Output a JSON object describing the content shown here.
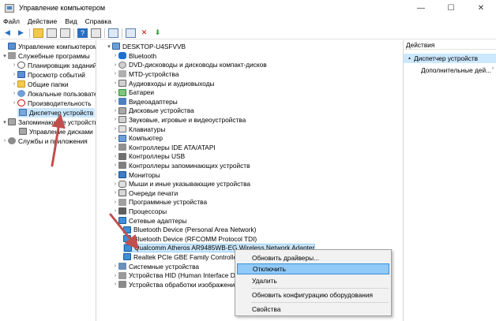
{
  "window": {
    "title": "Управление компьютером",
    "minimize": "—",
    "maximize": "☐",
    "close": "✕"
  },
  "menu": [
    "Файл",
    "Действие",
    "Вид",
    "Справка"
  ],
  "left_tree": [
    {
      "label": "Управление компьютером (л",
      "icon": "computer-icon",
      "exp": ""
    },
    {
      "label": "Служебные программы",
      "icon": "tools-icon",
      "exp": "▾"
    },
    {
      "label": "Планировщик заданий",
      "icon": "clock-icon",
      "exp": "›"
    },
    {
      "label": "Просмотр событий",
      "icon": "event-viewer-icon",
      "exp": "›"
    },
    {
      "label": "Общие папки",
      "icon": "folder-icon",
      "exp": "›"
    },
    {
      "label": "Локальные пользовате",
      "icon": "users-icon",
      "exp": "›"
    },
    {
      "label": "Производительность",
      "icon": "performance-icon",
      "exp": "›"
    },
    {
      "label": "Диспетчер устройств",
      "icon": "device-manager-icon",
      "exp": ""
    },
    {
      "label": "Запоминающие устройств",
      "icon": "storage-icon",
      "exp": "▾"
    },
    {
      "label": "Управление дисками",
      "icon": "disk-icon",
      "exp": ""
    },
    {
      "label": "Службы и приложения",
      "icon": "services-icon",
      "exp": "›"
    }
  ],
  "device_tree": {
    "root": "DESKTOP-U4SFVVB",
    "items": [
      {
        "label": "Bluetooth",
        "icon": "bluetooth-icon",
        "exp": "›"
      },
      {
        "label": "DVD-дисководы и дисководы компакт-дисков",
        "icon": "dvd-icon",
        "exp": "›"
      },
      {
        "label": "MTD-устройства",
        "icon": "mtd-icon",
        "exp": "›"
      },
      {
        "label": "Аудиовходы и аудиовыходы",
        "icon": "audio-icon",
        "exp": "›"
      },
      {
        "label": "Батареи",
        "icon": "battery-icon",
        "exp": "›"
      },
      {
        "label": "Видеоадаптеры",
        "icon": "video-adapter-icon",
        "exp": "›"
      },
      {
        "label": "Дисковые устройства",
        "icon": "disk-drive-icon",
        "exp": "›"
      },
      {
        "label": "Звуковые, игровые и видеоустройства",
        "icon": "sound-icon",
        "exp": "›"
      },
      {
        "label": "Клавиатуры",
        "icon": "keyboard-icon",
        "exp": "›"
      },
      {
        "label": "Компьютер",
        "icon": "computer-icon",
        "exp": "›"
      },
      {
        "label": "Контроллеры IDE ATA/ATAPI",
        "icon": "ide-icon",
        "exp": "›"
      },
      {
        "label": "Контроллеры USB",
        "icon": "usb-icon",
        "exp": "›"
      },
      {
        "label": "Контроллеры запоминающих устройств",
        "icon": "storage-controller-icon",
        "exp": "›"
      },
      {
        "label": "Мониторы",
        "icon": "monitor-icon",
        "exp": "›"
      },
      {
        "label": "Мыши и иные указывающие устройства",
        "icon": "mouse-icon",
        "exp": "›"
      },
      {
        "label": "Очереди печати",
        "icon": "print-queue-icon",
        "exp": "›"
      },
      {
        "label": "Программные устройства",
        "icon": "software-device-icon",
        "exp": "›"
      },
      {
        "label": "Процессоры",
        "icon": "processor-icon",
        "exp": "›"
      },
      {
        "label": "Сетевые адаптеры",
        "icon": "network-adapter-icon",
        "exp": "▾"
      }
    ],
    "network_children": [
      "Bluetooth Device (Personal Area Network)",
      "Bluetooth Device (RFCOMM Protocol TDI)",
      "Qualcomm Atheros AR9485WB-EG Wireless Network Adapter",
      "Realtek PCIe GBE Family Controller"
    ],
    "after_items": [
      {
        "label": "Системные устройства",
        "icon": "system-device-icon",
        "exp": "›"
      },
      {
        "label": "Устройства HID (Human Interface Dev",
        "icon": "hid-icon",
        "exp": "›"
      },
      {
        "label": "Устройства обработки изображени",
        "icon": "imaging-icon",
        "exp": "›"
      }
    ]
  },
  "actions": {
    "header": "Действия",
    "section": "Диспетчер устройств",
    "more": "Дополнительные дей...",
    "more_arrow": "›"
  },
  "context_menu": {
    "items": [
      "Обновить драйверы...",
      "Отключить",
      "Удалить",
      "Обновить конфигурацию оборудования",
      "Свойства"
    ]
  },
  "colors": {
    "selection": "#cce8ff",
    "highlight": "#91c9f7",
    "arrow": "#c0504d"
  }
}
